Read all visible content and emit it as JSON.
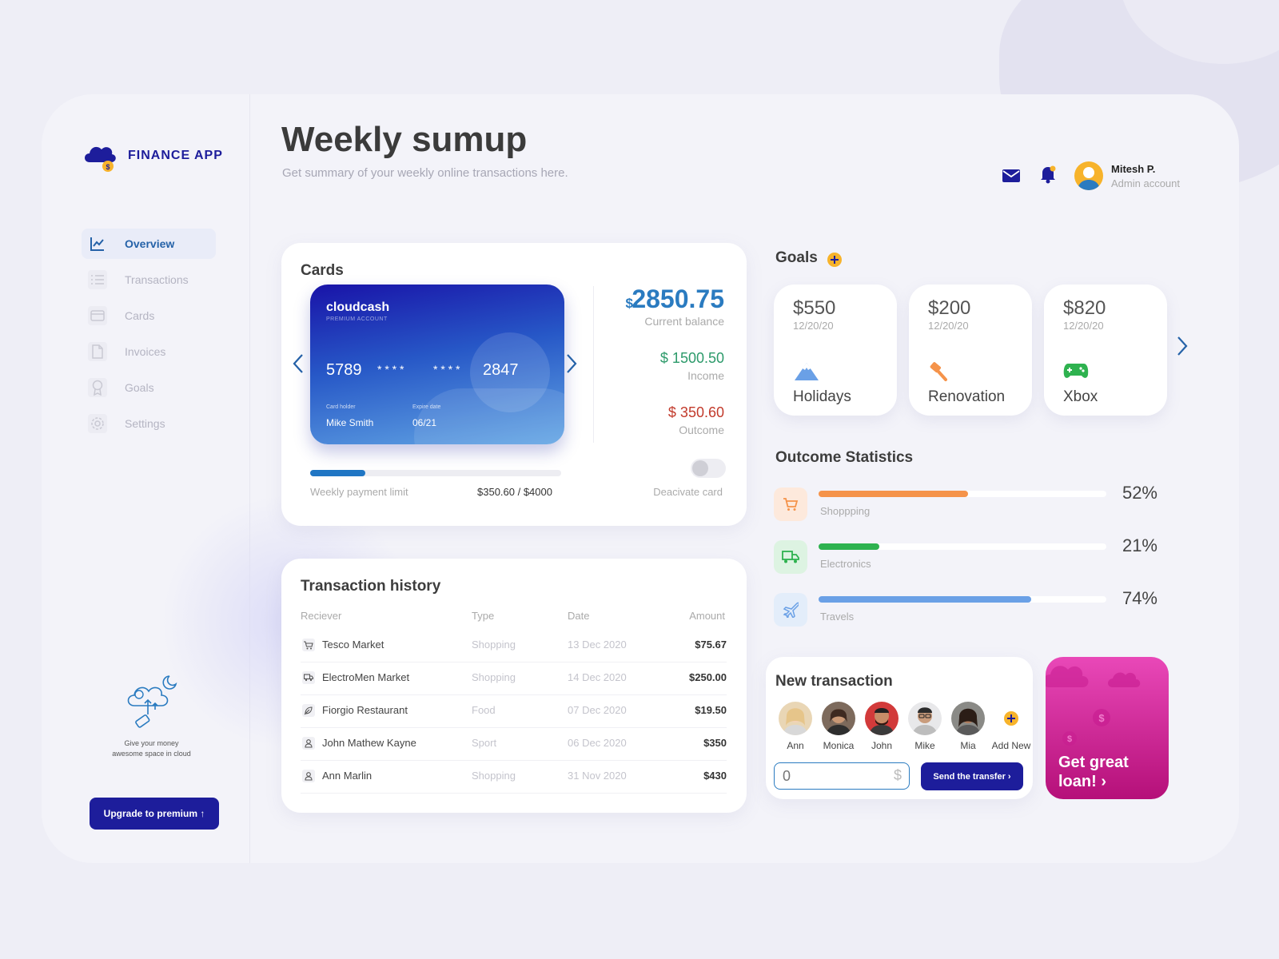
{
  "app": {
    "name": "FINANCE  APP"
  },
  "sidebar": {
    "items": [
      {
        "label": "Overview",
        "icon": "chart-line-icon"
      },
      {
        "label": "Transactions",
        "icon": "list-icon"
      },
      {
        "label": "Cards",
        "icon": "credit-card-icon"
      },
      {
        "label": "Invoices",
        "icon": "document-icon"
      },
      {
        "label": "Goals",
        "icon": "award-icon"
      },
      {
        "label": "Settings",
        "icon": "gear-icon"
      }
    ],
    "promo_line1": "Give your money",
    "promo_line2": "awesome space in cloud",
    "upgrade_label": "Upgrade to premium ↑"
  },
  "header": {
    "title": "Weekly sumup",
    "subtitle": "Get summary of your weekly online transactions here.",
    "user_name": "Mitesh P.",
    "user_role": "Admin account"
  },
  "cards": {
    "title": "Cards",
    "card": {
      "brand": "cloudcash",
      "tier": "PREMIUM ACCOUNT",
      "num1": "5789",
      "num2": "* * * *",
      "num3": "* * * *",
      "num4": "2847",
      "holder_label": "Card holder",
      "holder": "Mike Smith",
      "expiry_label": "Expire date",
      "expiry": "06/21"
    },
    "balance_currency": "$",
    "balance": "2850.75",
    "balance_label": "Current balance",
    "income": "$  1500.50",
    "income_label": "Income",
    "outcome": "$  350.60",
    "outcome_label": "Outcome",
    "limit_label": "Weekly payment limit",
    "limit_value": "$350.60 / $4000",
    "limit_fraction": 0.22,
    "deactivate_label": "Deacivate card",
    "colors": {
      "balance": "#2a7bc0",
      "income": "#2c9a6a",
      "outcome": "#c23a2b"
    }
  },
  "transactions": {
    "title": "Transaction history",
    "columns": [
      "Reciever",
      "Type",
      "Date",
      "Amount"
    ],
    "rows": [
      {
        "receiver": "Tesco Market",
        "type": "Shopping",
        "date": "13 Dec 2020",
        "amount": "$75.67",
        "icon": "cart-icon"
      },
      {
        "receiver": "ElectroMen Market",
        "type": "Shopping",
        "date": "14 Dec 2020",
        "amount": "$250.00",
        "icon": "truck-icon"
      },
      {
        "receiver": "Fiorgio Restaurant",
        "type": "Food",
        "date": "07 Dec 2020",
        "amount": "$19.50",
        "icon": "leaf-icon"
      },
      {
        "receiver": "John Mathew Kayne",
        "type": "Sport",
        "date": "06 Dec 2020",
        "amount": "$350",
        "icon": "user-icon"
      },
      {
        "receiver": "Ann Marlin",
        "type": "Shopping",
        "date": "31 Nov 2020",
        "amount": "$430",
        "icon": "user-icon"
      }
    ]
  },
  "goals": {
    "title": "Goals",
    "items": [
      {
        "amount": "$550",
        "date": "12/20/20",
        "name": "Holidays",
        "icon": "mountain-icon"
      },
      {
        "amount": "$200",
        "date": "12/20/20",
        "name": "Renovation",
        "icon": "brush-icon"
      },
      {
        "amount": "$820",
        "date": "12/20/20",
        "name": "Xbox",
        "icon": "gamepad-icon"
      }
    ]
  },
  "stats": {
    "title": "Outcome Statistics",
    "items": [
      {
        "label": "Shoppping",
        "pct": "52%",
        "value": 0.52,
        "color": "#f5934a",
        "bg": "#fde9dc",
        "icon": "cart-icon"
      },
      {
        "label": "Electronics",
        "pct": "21%",
        "value": 0.21,
        "color": "#2eb24f",
        "bg": "#ddf3e2",
        "icon": "truck-icon"
      },
      {
        "label": "Travels",
        "pct": "74%",
        "value": 0.74,
        "color": "#6aa0e6",
        "bg": "#e3edfa",
        "icon": "plane-icon"
      }
    ]
  },
  "new_transaction": {
    "title": "New transaction",
    "people": [
      "Ann",
      "Monica",
      "John",
      "Mike",
      "Mia"
    ],
    "add_label": "Add New",
    "amount_placeholder": "0",
    "currency": "$",
    "send_label": "Send the transfer ›"
  },
  "loan": {
    "line1": "Get great",
    "line2": "loan! ›"
  }
}
